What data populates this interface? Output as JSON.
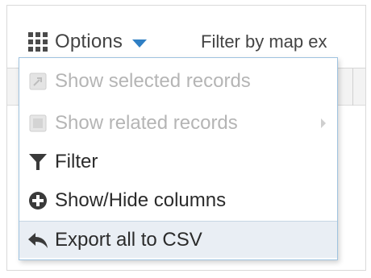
{
  "toolbar": {
    "options_label": "Options",
    "filter_map_label": "Filter by map ex"
  },
  "menu": {
    "items": [
      {
        "label": "Show selected records",
        "icon": "zoom-to-selection-icon",
        "enabled": false
      },
      {
        "label": "Show related records",
        "icon": "related-records-icon",
        "enabled": false,
        "submenu": true
      },
      {
        "label": "Filter",
        "icon": "filter-funnel-icon",
        "enabled": true
      },
      {
        "label": "Show/Hide columns",
        "icon": "plus-circle-icon",
        "enabled": true
      },
      {
        "label": "Export all to CSV",
        "icon": "export-arrow-icon",
        "enabled": true,
        "highlighted": true
      }
    ]
  },
  "colors": {
    "accent_caret": "#2f7fc4",
    "menu_border": "#9fc3e0",
    "disabled_text": "#b5b5b5",
    "highlight_bg": "#e9eef4"
  }
}
